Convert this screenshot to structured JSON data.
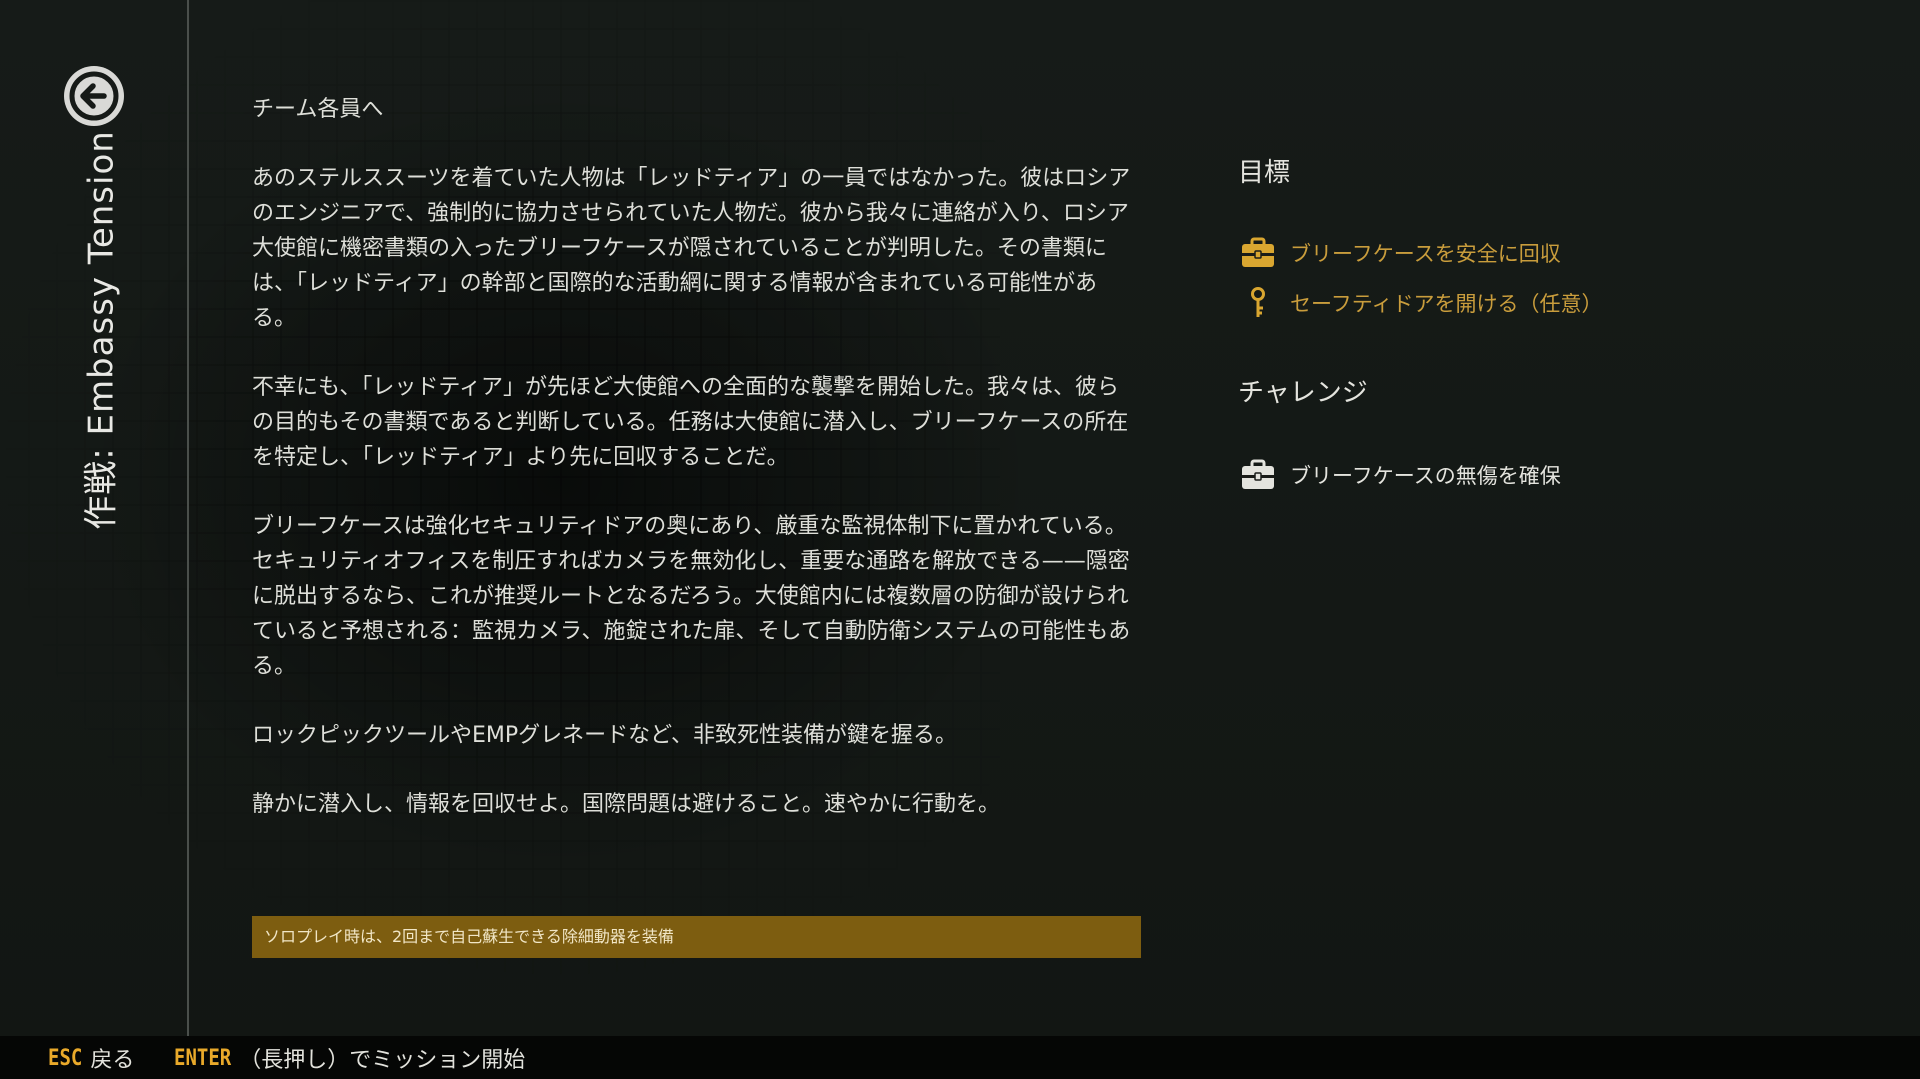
{
  "mission": {
    "title": "作戦: Embassy Tension"
  },
  "briefing": {
    "greeting": "チーム各員へ",
    "paragraphs": [
      "あのステルススーツを着ていた人物は「レッドティア」の一員ではなかった。彼はロシアのエンジニアで、強制的に協力させられていた人物だ。彼から我々に連絡が入り、ロシア大使館に機密書類の入ったブリーフケースが隠されていることが判明した。その書類には、「レッドティア」の幹部と国際的な活動網に関する情報が含まれている可能性がある。",
      "不幸にも、「レッドティア」が先ほど大使館への全面的な襲撃を開始した。我々は、彼らの目的もその書類であると判断している。任務は大使館に潜入し、ブリーフケースの所在を特定し、「レッドティア」より先に回収することだ。",
      "ブリーフケースは強化セキュリティドアの奥にあり、厳重な監視体制下に置かれている。セキュリティオフィスを制圧すればカメラを無効化し、重要な通路を解放できる——隠密に脱出するなら、これが推奨ルートとなるだろう。大使館内には複数層の防御が設けられていると予想される：監視カメラ、施錠された扉、そして自動防衛システムの可能性もある。",
      "ロックピックツールやEMPグレネードなど、非致死性装備が鍵を握る。",
      "静かに潜入し、情報を回収せよ。国際問題は避けること。速やかに行動を。"
    ],
    "solo_note": "ソロプレイ時は、2回まで自己蘇生できる除細動器を装備"
  },
  "objectives": {
    "heading": "目標",
    "items": [
      {
        "label": "ブリーフケースを安全に回収",
        "icon": "briefcase-icon",
        "color": "#c99d3c"
      },
      {
        "label": "セーフティドアを開ける（任意）",
        "icon": "key-icon",
        "color": "#c99d3c"
      }
    ]
  },
  "challenges": {
    "heading": "チャレンジ",
    "items": [
      {
        "label": "ブリーフケースの無傷を確保",
        "icon": "briefcase-icon",
        "color": "#e4e4de"
      }
    ]
  },
  "footer": {
    "esc_key": "ESC",
    "esc_label": "戻る",
    "enter_key": "ENTER",
    "enter_label": "（長押し）でミッション開始"
  },
  "colors": {
    "accent": "#e9a92a",
    "objective_gold": "#c99d3c",
    "note_bar": "#7d5d10",
    "background": "#141815"
  }
}
